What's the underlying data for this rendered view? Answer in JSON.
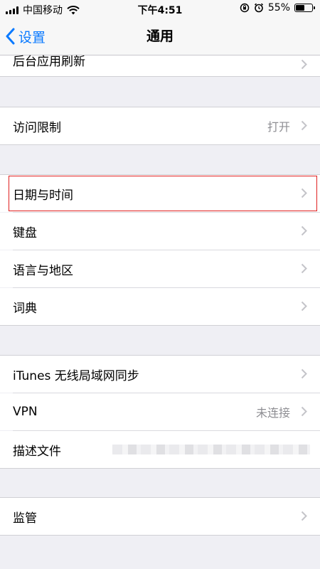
{
  "status_bar": {
    "carrier": "中国移动",
    "time": "下午4:51",
    "battery_percent": "55%",
    "battery_level": 0.55
  },
  "nav": {
    "back_label": "设置",
    "title": "通用"
  },
  "rows": {
    "background_refresh": {
      "label": "后台应用刷新"
    },
    "restrictions": {
      "label": "访问限制",
      "value": "打开"
    },
    "date_time": {
      "label": "日期与时间"
    },
    "keyboard": {
      "label": "键盘"
    },
    "language_region": {
      "label": "语言与地区"
    },
    "dictionary": {
      "label": "词典"
    },
    "itunes_wifi_sync": {
      "label": "iTunes 无线局域网同步"
    },
    "vpn": {
      "label": "VPN",
      "value": "未连接"
    },
    "profile": {
      "label": "描述文件"
    },
    "supervision": {
      "label": "监管"
    }
  },
  "colors": {
    "accent": "#0a7aff",
    "highlight_border": "#e02020",
    "group_background": "#efeff4",
    "secondary_text": "#8e8e93"
  },
  "icons": [
    "signal-bars-icon",
    "wifi-icon",
    "orientation-lock-icon",
    "alarm-icon",
    "battery-icon",
    "chevron-left-icon",
    "chevron-right-icon"
  ]
}
